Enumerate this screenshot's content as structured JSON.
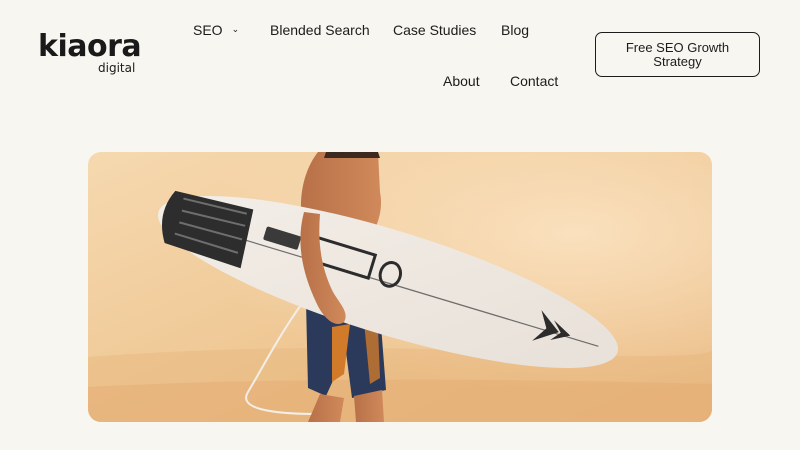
{
  "brand": {
    "name": "kiaora",
    "sub": "digital"
  },
  "nav": {
    "seo": "SEO",
    "blended_search": "Blended Search",
    "case_studies": "Case Studies",
    "blog": "Blog",
    "about": "About",
    "contact": "Contact"
  },
  "cta": {
    "label": "Free SEO Growth Strategy"
  },
  "hero": {
    "image": "surfer-carrying-surfboard-photo"
  },
  "icons": {
    "seo_dropdown": "chevron-down-icon"
  },
  "colors": {
    "background": "#f8f6f1",
    "text": "#1c1c1c",
    "hero_sand": "#efc996"
  }
}
